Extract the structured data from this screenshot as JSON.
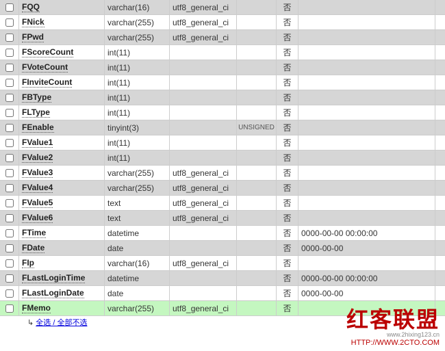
{
  "rows": [
    {
      "name": "FQQ",
      "type": "varchar(16)",
      "coll": "utf8_general_ci",
      "attr": "",
      "null": "否",
      "def": "",
      "odd": true
    },
    {
      "name": "FNick",
      "type": "varchar(255)",
      "coll": "utf8_general_ci",
      "attr": "",
      "null": "否",
      "def": "",
      "odd": false
    },
    {
      "name": "FPwd",
      "type": "varchar(255)",
      "coll": "utf8_general_ci",
      "attr": "",
      "null": "否",
      "def": "",
      "odd": true
    },
    {
      "name": "FScoreCount",
      "type": "int(11)",
      "coll": "",
      "attr": "",
      "null": "否",
      "def": "",
      "odd": false
    },
    {
      "name": "FVoteCount",
      "type": "int(11)",
      "coll": "",
      "attr": "",
      "null": "否",
      "def": "",
      "odd": true
    },
    {
      "name": "FInviteCount",
      "type": "int(11)",
      "coll": "",
      "attr": "",
      "null": "否",
      "def": "",
      "odd": false
    },
    {
      "name": "FBType",
      "type": "int(11)",
      "coll": "",
      "attr": "",
      "null": "否",
      "def": "",
      "odd": true
    },
    {
      "name": "FLType",
      "type": "int(11)",
      "coll": "",
      "attr": "",
      "null": "否",
      "def": "",
      "odd": false
    },
    {
      "name": "FEnable",
      "type": "tinyint(3)",
      "coll": "",
      "attr": "UNSIGNED",
      "null": "否",
      "def": "",
      "odd": true
    },
    {
      "name": "FValue1",
      "type": "int(11)",
      "coll": "",
      "attr": "",
      "null": "否",
      "def": "",
      "odd": false
    },
    {
      "name": "FValue2",
      "type": "int(11)",
      "coll": "",
      "attr": "",
      "null": "否",
      "def": "",
      "odd": true
    },
    {
      "name": "FValue3",
      "type": "varchar(255)",
      "coll": "utf8_general_ci",
      "attr": "",
      "null": "否",
      "def": "",
      "odd": false
    },
    {
      "name": "FValue4",
      "type": "varchar(255)",
      "coll": "utf8_general_ci",
      "attr": "",
      "null": "否",
      "def": "",
      "odd": true
    },
    {
      "name": "FValue5",
      "type": "text",
      "coll": "utf8_general_ci",
      "attr": "",
      "null": "否",
      "def": "",
      "odd": false
    },
    {
      "name": "FValue6",
      "type": "text",
      "coll": "utf8_general_ci",
      "attr": "",
      "null": "否",
      "def": "",
      "odd": true
    },
    {
      "name": "FTime",
      "type": "datetime",
      "coll": "",
      "attr": "",
      "null": "否",
      "def": "0000-00-00 00:00:00",
      "odd": false
    },
    {
      "name": "FDate",
      "type": "date",
      "coll": "",
      "attr": "",
      "null": "否",
      "def": "0000-00-00",
      "odd": true
    },
    {
      "name": "FIp",
      "type": "varchar(16)",
      "coll": "utf8_general_ci",
      "attr": "",
      "null": "否",
      "def": "",
      "odd": false
    },
    {
      "name": "FLastLoginTime",
      "type": "datetime",
      "coll": "",
      "attr": "",
      "null": "否",
      "def": "0000-00-00 00:00:00",
      "odd": true
    },
    {
      "name": "FLastLoginDate",
      "type": "date",
      "coll": "",
      "attr": "",
      "null": "否",
      "def": "0000-00-00",
      "odd": false
    },
    {
      "name": "FMemo",
      "type": "varchar(255)",
      "coll": "utf8_general_ci",
      "attr": "",
      "null": "否",
      "def": "",
      "odd": true,
      "hl": true
    }
  ],
  "footer": {
    "check_all": "全选 / 全部不选"
  },
  "watermark": {
    "brand": "红客联盟",
    "site": "www.2hixing123.cn",
    "url": "HTTP://WWW.2CTO.COM"
  }
}
